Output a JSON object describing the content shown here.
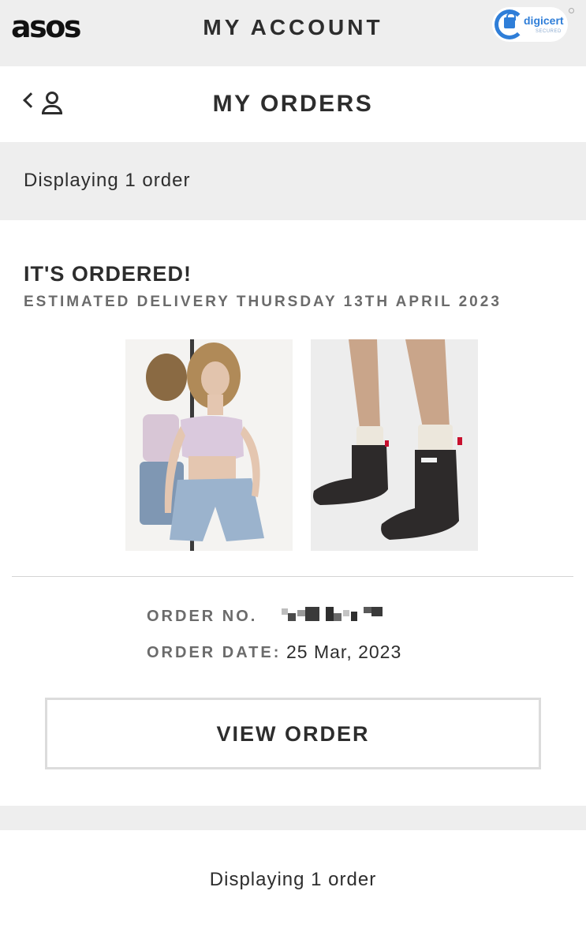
{
  "header": {
    "logo": "asos",
    "title": "MY ACCOUNT",
    "trust_badge": {
      "name": "digicert",
      "subtitle": "SECURED"
    },
    "brand_color": "#2f7ed8"
  },
  "page": {
    "title": "MY ORDERS",
    "back_icon": "chevron-left-icon",
    "account_icon": "person-icon"
  },
  "summary": {
    "count_text": "Displaying 1 order"
  },
  "order": {
    "status": "IT'S ORDERED!",
    "delivery": "ESTIMATED DELIVERY THURSDAY 13TH APRIL 2023",
    "products": [
      {
        "name": "product-image-top"
      },
      {
        "name": "product-image-boots"
      }
    ],
    "order_no_label": "ORDER NO.",
    "order_date_label": "ORDER DATE:",
    "order_date": "25 Mar, 2023",
    "view_button": "VIEW ORDER"
  },
  "footer": {
    "count_text": "Displaying 1 order"
  },
  "colors": {
    "background_band": "#eeeeee",
    "text": "#2d2d2d",
    "muted": "#6b6b6b"
  }
}
